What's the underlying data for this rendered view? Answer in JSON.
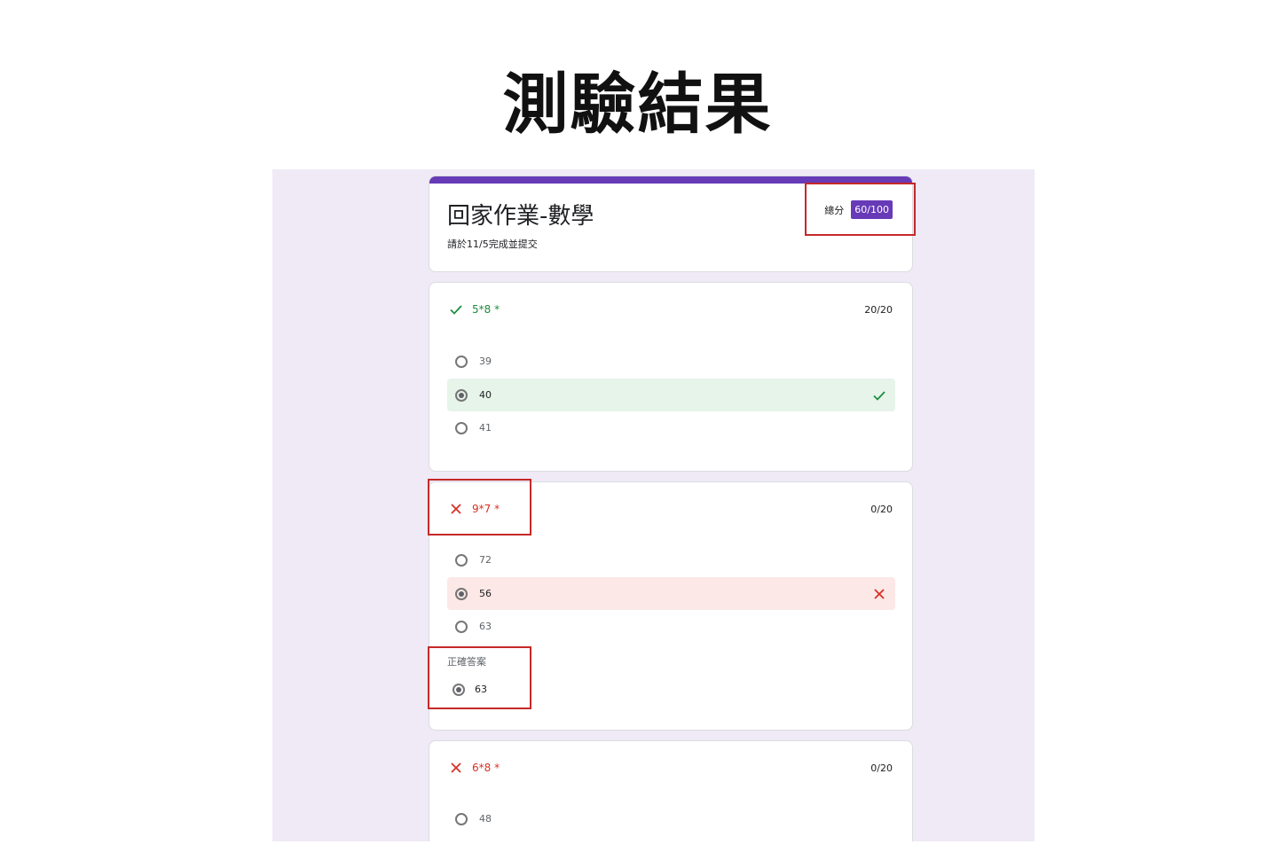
{
  "slide": {
    "title": "測驗結果"
  },
  "form": {
    "title": "回家作業-數學",
    "description": "請於11/5完成並提交",
    "total_label": "總分",
    "total_score": "60/100",
    "accent_color": "#673ab7"
  },
  "questions": [
    {
      "status_icon": "check-icon",
      "prompt": "5*8 *",
      "score": "20/20",
      "options": [
        {
          "label": "39",
          "selected": false
        },
        {
          "label": "40",
          "selected": true,
          "result": "correct"
        },
        {
          "label": "41",
          "selected": false
        }
      ]
    },
    {
      "status_icon": "close-icon",
      "prompt": "9*7 *",
      "score": "0/20",
      "options": [
        {
          "label": "72",
          "selected": false
        },
        {
          "label": "56",
          "selected": true,
          "result": "wrong"
        },
        {
          "label": "63",
          "selected": false
        }
      ],
      "correct_answer_label": "正確答案",
      "correct_answer": "63"
    },
    {
      "status_icon": "close-icon",
      "prompt": "6*8 *",
      "score": "0/20",
      "options": [
        {
          "label": "48",
          "selected": false
        }
      ]
    }
  ],
  "colors": {
    "correct": "#1e8e3e",
    "wrong": "#d93025",
    "highlight_box": "#c62828",
    "background": "#efeaf6"
  }
}
